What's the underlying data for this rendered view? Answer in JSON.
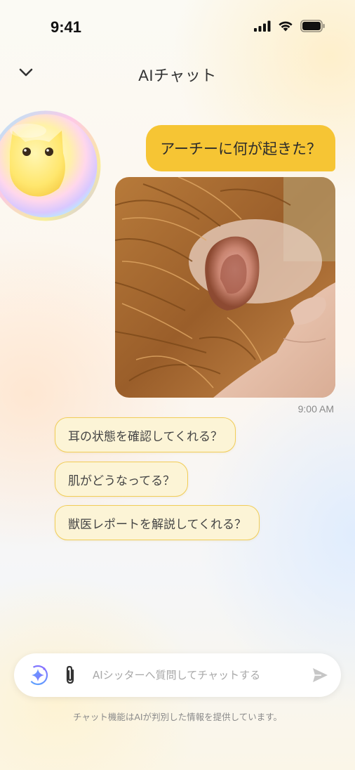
{
  "status_bar": {
    "time": "9:41",
    "icons": [
      "signal-icon",
      "wifi-icon",
      "battery-icon"
    ]
  },
  "header": {
    "title": "AIチャット",
    "back_icon": "chevron-down-icon"
  },
  "mascot": {
    "icon": "ai-cat-mascot-icon"
  },
  "chat": {
    "user_message": "アーチーに何が起きた？",
    "photo_icon": "dog-ear-photo",
    "timestamp": "9:00 AM"
  },
  "suggestions": [
    "耳の状態を確認してくれる？",
    "肌がどうなってる？",
    "獣医レポートを解説してくれる？"
  ],
  "composer": {
    "ai_icon": "sparkle-icon",
    "attach_icon": "paperclip-icon",
    "placeholder": "AIシッターへ質問してチャットする",
    "value": "",
    "send_icon": "send-icon"
  },
  "disclaimer": "チャット機能はAIが判別した情報を提供しています。",
  "colors": {
    "accent": "#f6c534",
    "suggestion_bg": "#fcf4d6",
    "suggestion_border": "#f1cd58",
    "text": "#333333",
    "muted": "#8b8b8b"
  }
}
